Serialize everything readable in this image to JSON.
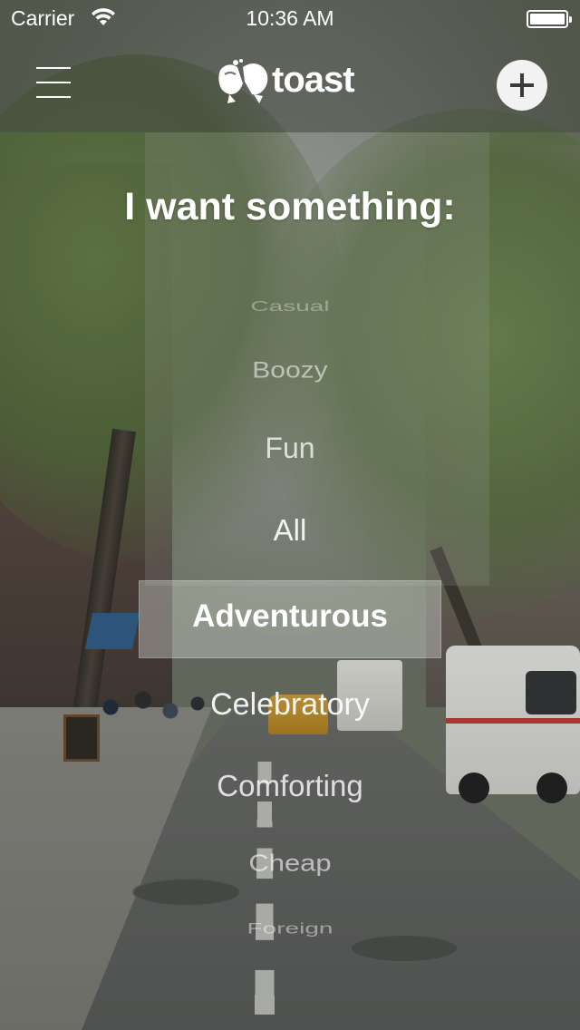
{
  "status_bar": {
    "carrier": "Carrier",
    "time": "10:36 AM"
  },
  "nav": {
    "menu_icon": "hamburger-menu-icon",
    "logo_text": "toast",
    "logo_icon": "toast-glasses-icon",
    "add_icon": "plus-icon"
  },
  "heading": "I want something:",
  "picker": {
    "selected": "Adventurous",
    "items": [
      "Casual",
      "Boozy",
      "Fun",
      "All",
      "Adventurous",
      "Celebratory",
      "Comforting",
      "Cheap",
      "Foreign"
    ]
  },
  "colors": {
    "text": "#ffffff",
    "add_button_bg": "#f2f2f2",
    "selection_bg": "rgba(220,225,220,0.38)"
  }
}
